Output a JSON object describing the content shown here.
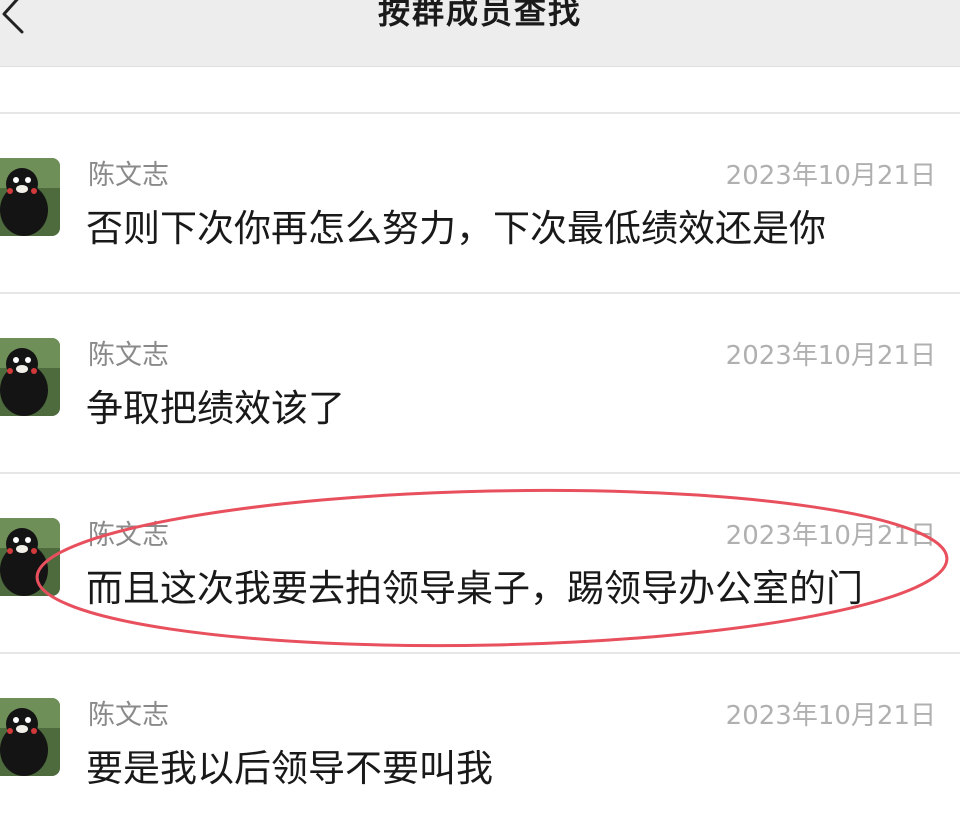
{
  "header": {
    "title": "按群成员查找",
    "back_icon": "chevron-left-icon"
  },
  "messages": [
    {
      "sender": "陈文志",
      "date": "2023年10月21日",
      "text": "否则下次你再怎么努力，下次最低绩效还是你"
    },
    {
      "sender": "陈文志",
      "date": "2023年10月21日",
      "text": "争取把绩效该了"
    },
    {
      "sender": "陈文志",
      "date": "2023年10月21日",
      "text": "而且这次我要去拍领导桌子，踢领导办公室的门"
    },
    {
      "sender": "陈文志",
      "date": "2023年10月21日",
      "text": "要是我以后领导不要叫我"
    }
  ],
  "colors": {
    "highlight_ring": "#e8505e",
    "navbar_bg": "#ededed"
  }
}
